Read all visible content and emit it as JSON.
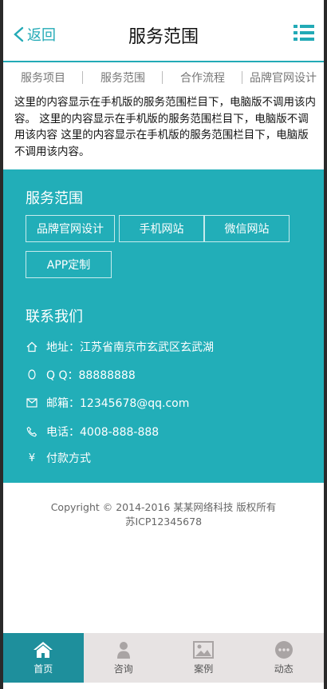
{
  "header": {
    "back_label": "返回",
    "title": "服务范围"
  },
  "tabs": [
    {
      "label": "服务项目"
    },
    {
      "label": "服务范围"
    },
    {
      "label": "合作流程"
    },
    {
      "label": "品牌官网设计"
    }
  ],
  "content": {
    "text": "这里的内容显示在手机版的服务范围栏目下，电脑版不调用该内容。 这里的内容显示在手机版的服务范围栏目下，电脑版不调用该内容 这里的内容显示在手机版的服务范围栏目下，电脑版不调用该内容。"
  },
  "services": {
    "title": "服务范围",
    "items": [
      {
        "label": "品牌官网设计"
      },
      {
        "label": "手机网站"
      },
      {
        "label": "微信网站"
      },
      {
        "label": "APP定制"
      }
    ]
  },
  "contact": {
    "title": "联系我们",
    "rows": [
      {
        "icon": "home-icon",
        "text": "地址：江苏省南京市玄武区玄武湖"
      },
      {
        "icon": "qq-icon",
        "text": "Q Q：88888888"
      },
      {
        "icon": "mail-icon",
        "text": "邮箱：12345678@qq.com"
      },
      {
        "icon": "phone-icon",
        "text": "电话：4008-888-888"
      },
      {
        "icon": "yen-icon",
        "text": "付款方式"
      }
    ]
  },
  "footer": {
    "copyright": "Copyright © 2014-2016 某某网络科技 版权所有",
    "icp": "苏ICP12345678"
  },
  "bottom_nav": [
    {
      "label": "首页",
      "icon": "home-icon",
      "active": true
    },
    {
      "label": "咨询",
      "icon": "user-icon",
      "active": false
    },
    {
      "label": "案例",
      "icon": "image-icon",
      "active": false
    },
    {
      "label": "动态",
      "icon": "chat-icon",
      "active": false
    }
  ],
  "colors": {
    "accent": "#23aab6",
    "section_bg": "#22aeb8",
    "nav_active": "#1e8f9c",
    "nav_bg": "#e7e3e3"
  }
}
